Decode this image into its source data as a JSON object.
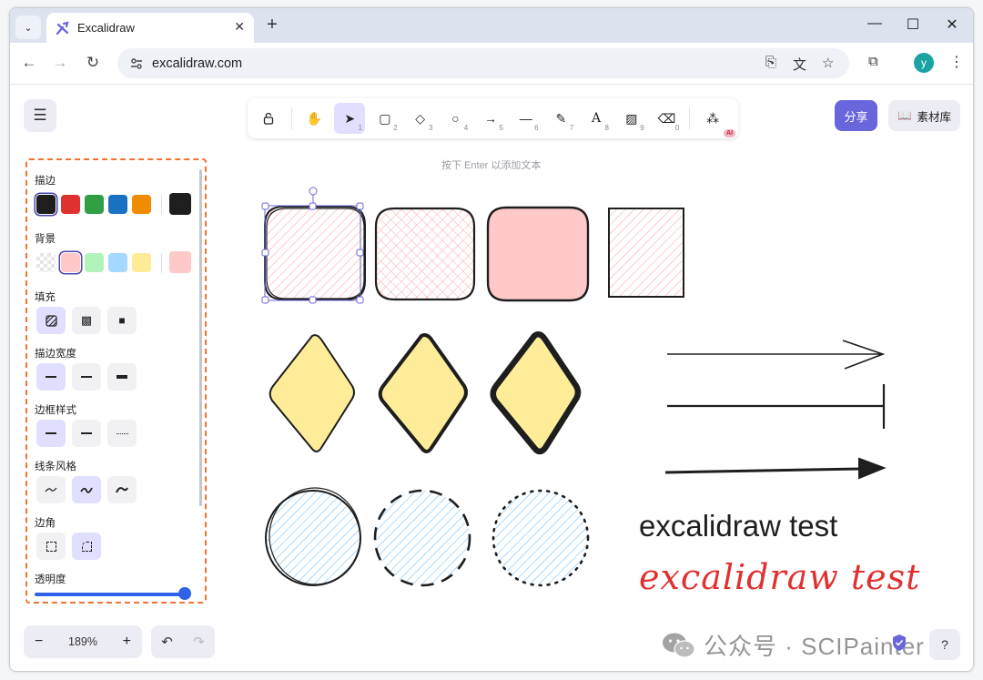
{
  "browser": {
    "tab_title": "Excalidraw",
    "url": "excalidraw.com",
    "avatar_letter": "y"
  },
  "toolbar": {
    "tools": [
      {
        "name": "lock",
        "key": ""
      },
      {
        "name": "hand",
        "key": ""
      },
      {
        "name": "selection",
        "key": "1",
        "active": true
      },
      {
        "name": "rectangle",
        "key": "2"
      },
      {
        "name": "diamond",
        "key": "3"
      },
      {
        "name": "ellipse",
        "key": "4"
      },
      {
        "name": "arrow",
        "key": "5"
      },
      {
        "name": "line",
        "key": "6"
      },
      {
        "name": "draw",
        "key": "7"
      },
      {
        "name": "text",
        "key": "8"
      },
      {
        "name": "image",
        "key": "9"
      },
      {
        "name": "eraser",
        "key": "0"
      }
    ],
    "more_tools_badge": "AI",
    "share_label": "分享",
    "library_label": "素材库",
    "hint": "按下 Enter 以添加文本"
  },
  "properties": {
    "stroke_label": "描边",
    "stroke_colors": [
      "#1e1e1e",
      "#e03131",
      "#2f9e44",
      "#1971c2",
      "#f08c00"
    ],
    "stroke_current": "#1e1e1e",
    "background_label": "背景",
    "background_colors": [
      "transparent",
      "#ffc9c9",
      "#b2f2bb",
      "#a5d8ff",
      "#ffec99"
    ],
    "background_current": "#ffc9c9",
    "fill_label": "填充",
    "stroke_width_label": "描边宽度",
    "stroke_style_label": "边框样式",
    "sloppiness_label": "线条风格",
    "edges_label": "边角",
    "opacity_label": "透明度",
    "opacity_value": 100
  },
  "footer": {
    "zoom": "189%",
    "zoom_out": "−",
    "zoom_in": "+"
  },
  "canvas": {
    "text_normal": "excalidraw test",
    "text_hand": "excalidraw test"
  },
  "watermark": "公众号 · SCIPainter",
  "colors": {
    "accent": "#6965db",
    "pink_fill": "#ffc9c9",
    "yellow_fill": "#ffec99",
    "blue_fill": "#a5d8ff"
  }
}
